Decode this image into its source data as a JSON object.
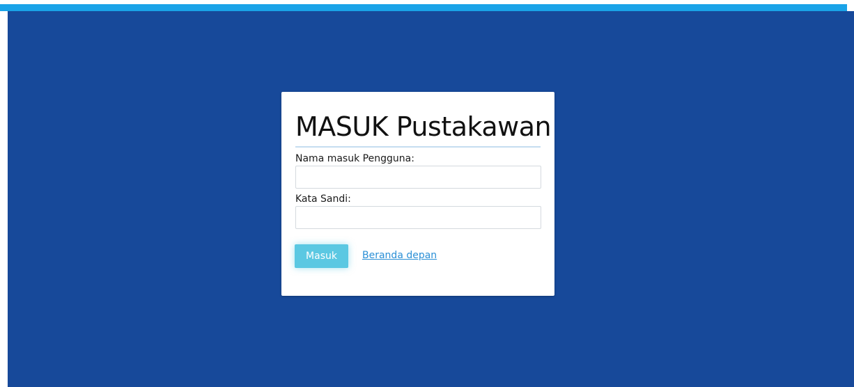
{
  "login": {
    "title": "MASUK Pustakawan",
    "username_label": "Nama masuk Pengguna:",
    "username_value": "",
    "password_label": "Kata Sandi:",
    "password_value": "",
    "submit_label": "Masuk",
    "home_link": "Beranda depan"
  },
  "colors": {
    "background": "#17499a",
    "top_strip": "#1aa3e8",
    "button": "#5bc8e2",
    "link": "#2a8fd6"
  }
}
